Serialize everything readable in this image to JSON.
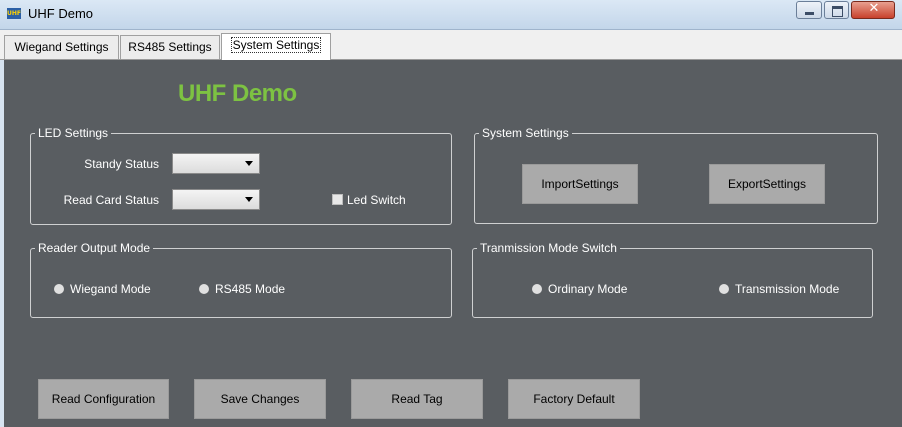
{
  "window": {
    "title": "UHF Demo",
    "icon_label": "UHF",
    "icon": "app-icon"
  },
  "tabs": [
    {
      "label": "Wiegand Settings"
    },
    {
      "label": "RS485 Settings"
    },
    {
      "label": "System Settings",
      "active": true
    }
  ],
  "logo": "UHF Demo",
  "led_settings": {
    "title": "LED Settings",
    "standby_label": "Standy Status",
    "standby_value": "",
    "read_card_label": "Read Card Status",
    "read_card_value": "",
    "led_switch_label": "Led Switch",
    "led_switch_checked": false
  },
  "system_settings": {
    "title": "System Settings",
    "import_label": "ImportSettings",
    "export_label": "ExportSettings"
  },
  "reader_output": {
    "title": "Reader Output Mode",
    "wiegand_label": "Wiegand Mode",
    "rs485_label": "RS485 Mode"
  },
  "transmission": {
    "title": "Tranmission Mode Switch",
    "ordinary_label": "Ordinary Mode",
    "transmission_label": "Transmission Mode"
  },
  "actions": {
    "read_config": "Read Configuration",
    "save_changes": "Save Changes",
    "read_tag": "Read Tag",
    "factory_default": "Factory Default"
  },
  "colors": {
    "panel_bg": "#595d61",
    "logo": "#7dc242",
    "button_bg": "#aaaaaa"
  }
}
